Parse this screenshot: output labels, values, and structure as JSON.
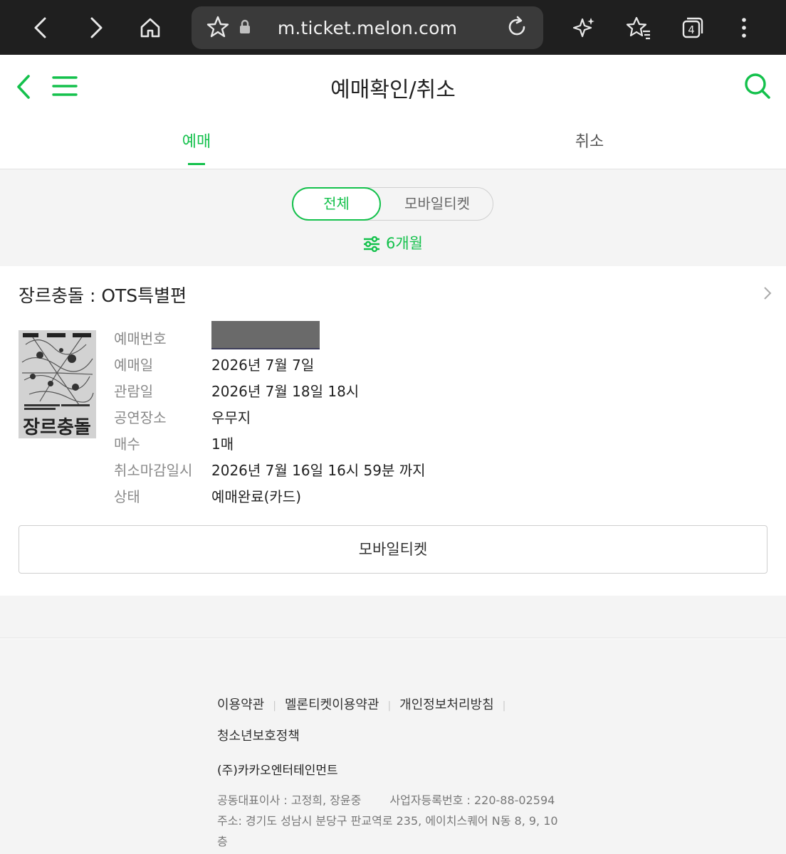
{
  "browser": {
    "url": "m.ticket.melon.com",
    "tab_count": "4"
  },
  "header": {
    "title": "예매확인/취소"
  },
  "tabs": [
    {
      "label": "예매",
      "active": true
    },
    {
      "label": "취소",
      "active": false
    }
  ],
  "filter": {
    "segments": [
      "전체",
      "모바일티켓"
    ],
    "selected": "전체",
    "period": "6개월"
  },
  "booking": {
    "title": "장르충돌 : OTS특별편",
    "poster_text": "장르충돌",
    "fields": [
      {
        "label": "예매번호",
        "value": ""
      },
      {
        "label": "예매일",
        "value": "2026년 7월 7일"
      },
      {
        "label": "관람일",
        "value": "2026년 7월 18일 18시"
      },
      {
        "label": "공연장소",
        "value": "우무지"
      },
      {
        "label": "매수",
        "value": "1매"
      },
      {
        "label": "취소마감일시",
        "value": "2026년 7월 16일 16시 59분 까지"
      },
      {
        "label": "상태",
        "value": "예매완료(카드)"
      }
    ],
    "mobile_ticket_button": "모바일티켓"
  },
  "footer": {
    "links": [
      "이용약관",
      "멜론티켓이용약관",
      "개인정보처리방침"
    ],
    "links2": [
      "청소년보호정책"
    ],
    "company": "(주)카카오엔터테인먼트",
    "ceo": "공동대표이사 : 고정희, 장윤중",
    "business_no": "사업자등록번호 : 220-88-02594",
    "address": "주소: 경기도 성남시 분당구 판교역로 235, 에이치스퀘어 N동 8, 9, 10층"
  },
  "colors": {
    "accent": "#14c14c",
    "chrome_bg": "#1f1f1f"
  }
}
